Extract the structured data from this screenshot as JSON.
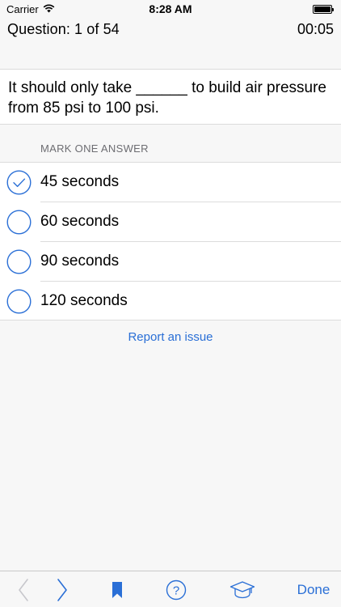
{
  "status_bar": {
    "carrier": "Carrier",
    "time": "8:28 AM",
    "wifi_icon": "wifi-icon",
    "battery_icon": "battery-icon"
  },
  "header": {
    "question_label": "Question: 1 of 54",
    "timer": "00:05"
  },
  "question": {
    "text": "It should only take ______ to build air pressure from 85 psi to 100 psi."
  },
  "answers": {
    "section_title": "MARK ONE ANSWER",
    "options": [
      {
        "label": "45 seconds",
        "selected": true
      },
      {
        "label": "60 seconds",
        "selected": false
      },
      {
        "label": "90 seconds",
        "selected": false
      },
      {
        "label": "120 seconds",
        "selected": false
      }
    ]
  },
  "report_link": "Report an issue",
  "toolbar": {
    "back_icon": "chevron-left-icon",
    "forward_icon": "chevron-right-icon",
    "bookmark_icon": "bookmark-icon",
    "help_icon": "help-circle-icon",
    "help_glyph": "?",
    "study_icon": "graduation-cap-icon",
    "done_label": "Done"
  },
  "colors": {
    "accent": "#2a6fd6",
    "disabled": "#c7c7cc",
    "background": "#f7f7f7",
    "separator": "#dcdcdc",
    "section_header": "#6d6d72"
  }
}
